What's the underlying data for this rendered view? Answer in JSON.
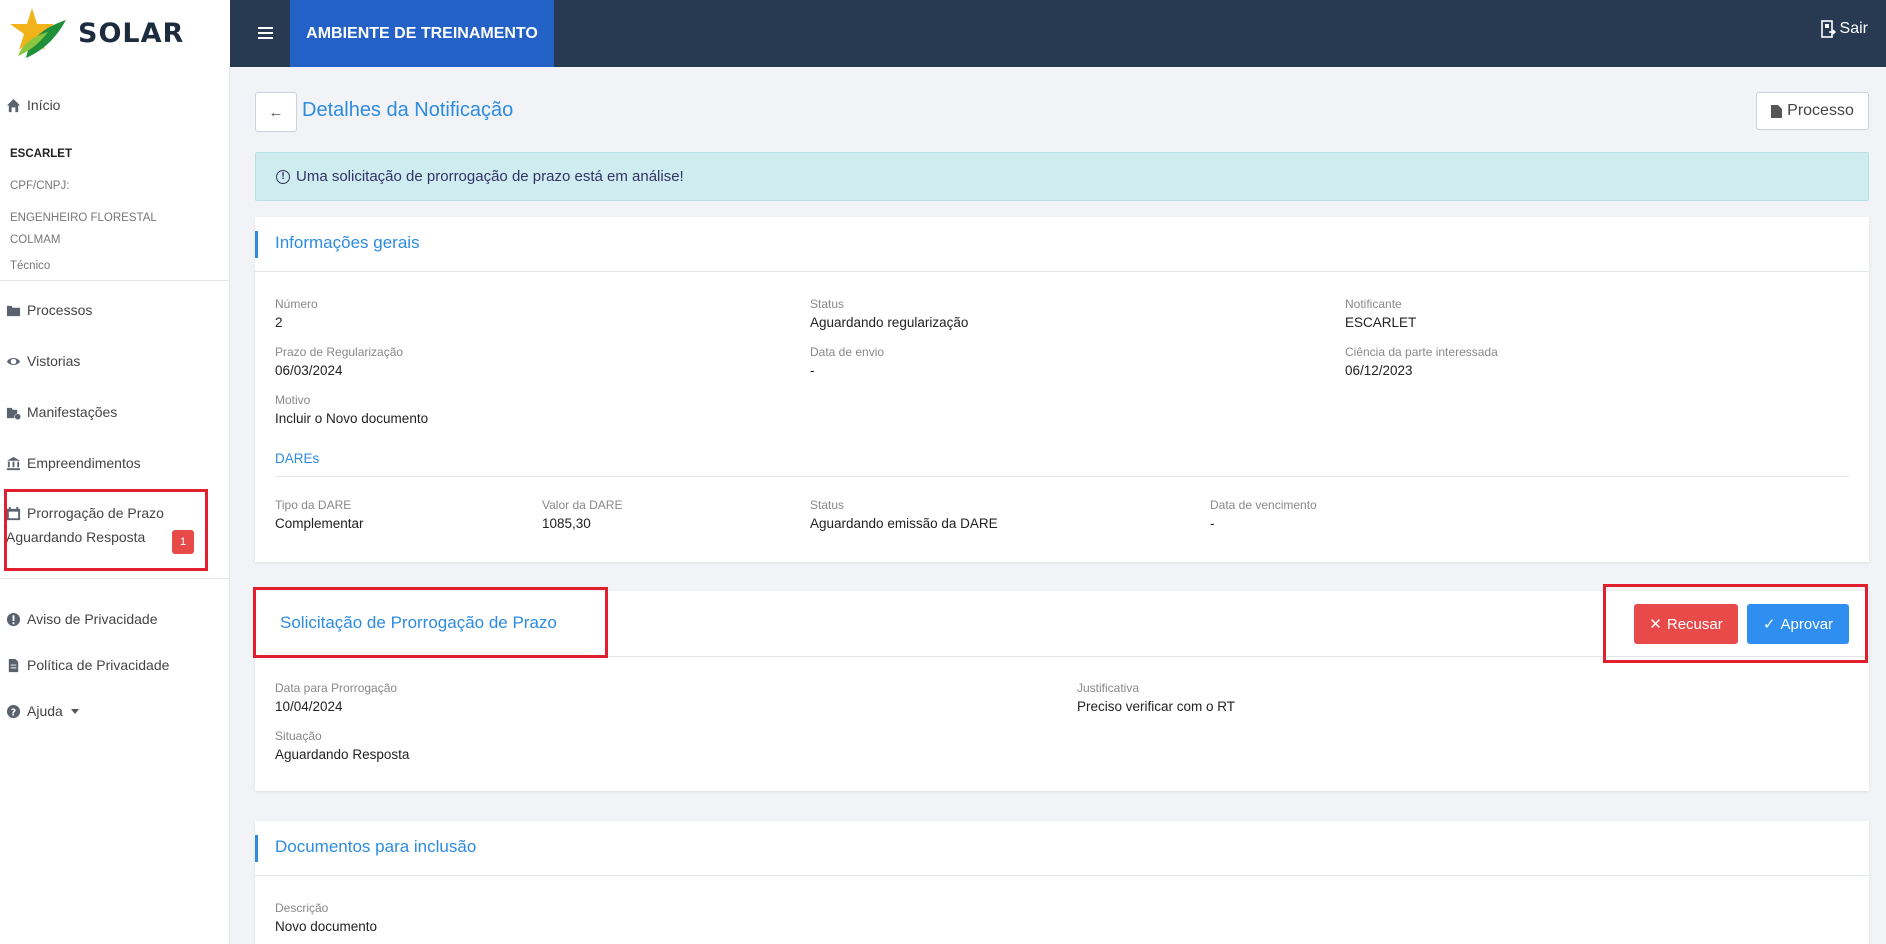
{
  "brand": {
    "name": "SOLAR"
  },
  "topbar": {
    "environment": "AMBIENTE DE TREINAMENTO",
    "logout": "Sair"
  },
  "sidebar": {
    "home": "Início",
    "profile": {
      "name": "ESCARLET",
      "cpf_label": "CPF/CNPJ:",
      "profession_line1": "ENGENHEIRO FLORESTAL",
      "profession_line2": "COLMAM",
      "role": "Técnico"
    },
    "items": [
      {
        "label": "Processos",
        "icon": "folder-icon"
      },
      {
        "label": "Vistorias",
        "icon": "eye-icon"
      },
      {
        "label": "Manifestações",
        "icon": "folder-clock-icon"
      },
      {
        "label": "Empreendimentos",
        "icon": "bank-icon"
      }
    ],
    "prorrogacao": {
      "label": "Prorrogação de Prazo",
      "sub": "Aguardando Resposta",
      "count": "1"
    },
    "footer_items": [
      {
        "label": "Aviso de Privacidade",
        "icon": "alert-circle-icon"
      },
      {
        "label": "Política de Privacidade",
        "icon": "document-icon"
      },
      {
        "label": "Ajuda",
        "icon": "help-icon"
      }
    ]
  },
  "page": {
    "title": "Detalhes da Notificação",
    "process_button": "Processo",
    "alert": "Uma solicitação de prorrogação de prazo está em análise!"
  },
  "info": {
    "title": "Informações gerais",
    "numero": {
      "label": "Número",
      "value": "2"
    },
    "status": {
      "label": "Status",
      "value": "Aguardando regularização"
    },
    "notificante": {
      "label": "Notificante",
      "value": "ESCARLET"
    },
    "prazo": {
      "label": "Prazo de Regularização",
      "value": "06/03/2024"
    },
    "envio": {
      "label": "Data de envio",
      "value": "-"
    },
    "ciencia": {
      "label": "Ciência da parte interessada",
      "value": "06/12/2023"
    },
    "motivo": {
      "label": "Motivo",
      "value": "Incluir o Novo documento"
    },
    "dares_title": "DAREs",
    "dare": {
      "tipo": {
        "label": "Tipo da DARE",
        "value": "Complementar"
      },
      "valor": {
        "label": "Valor da DARE",
        "value": "1085,30"
      },
      "status": {
        "label": "Status",
        "value": "Aguardando emissão da DARE"
      },
      "vencimento": {
        "label": "Data de vencimento",
        "value": "-"
      }
    }
  },
  "solicitacao": {
    "title": "Solicitação de Prorrogação de Prazo",
    "reject": "Recusar",
    "approve": "Aprovar",
    "data": {
      "label": "Data para Prorrogação",
      "value": "10/04/2024"
    },
    "justificativa": {
      "label": "Justificativa",
      "value": "Preciso verificar com o RT"
    },
    "situacao": {
      "label": "Situação",
      "value": "Aguardando Resposta"
    }
  },
  "documentos": {
    "title": "Documentos para inclusão",
    "descricao": {
      "label": "Descrição",
      "value": "Novo documento"
    }
  },
  "colors": {
    "topbar": "#283a52",
    "env": "#2361c7",
    "accent": "#2d8be0",
    "danger": "#e84a4a",
    "primary": "#2e8ff0",
    "highlight": "#e0202e"
  }
}
